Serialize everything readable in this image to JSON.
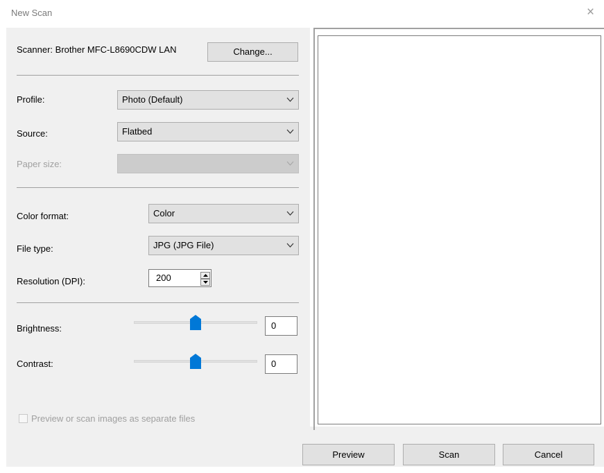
{
  "window": {
    "title": "New Scan",
    "close_icon": "×"
  },
  "scanner": {
    "label": "Scanner: Brother MFC-L8690CDW LAN",
    "change_button": "Change..."
  },
  "fields": {
    "profile": {
      "label": "Profile:",
      "value": "Photo (Default)"
    },
    "source": {
      "label": "Source:",
      "value": "Flatbed"
    },
    "paper_size": {
      "label": "Paper size:",
      "value": "",
      "disabled": true
    },
    "color_format": {
      "label": "Color format:",
      "value": "Color"
    },
    "file_type": {
      "label": "File type:",
      "value": "JPG (JPG File)"
    },
    "resolution": {
      "label": "Resolution (DPI):",
      "value": "200"
    },
    "brightness": {
      "label": "Brightness:",
      "value": "0",
      "slider_level": 0.5
    },
    "contrast": {
      "label": "Contrast:",
      "value": "0",
      "slider_level": 0.5
    },
    "separate_files": {
      "label": "Preview or scan images as separate files",
      "checked": false,
      "disabled": true
    }
  },
  "buttons": {
    "preview": "Preview",
    "scan": "Scan",
    "cancel": "Cancel"
  },
  "colors": {
    "dialog_background": "#f0f0f0",
    "slider_thumb": "#0078d7",
    "disabled_text": "#a0a0a0"
  }
}
